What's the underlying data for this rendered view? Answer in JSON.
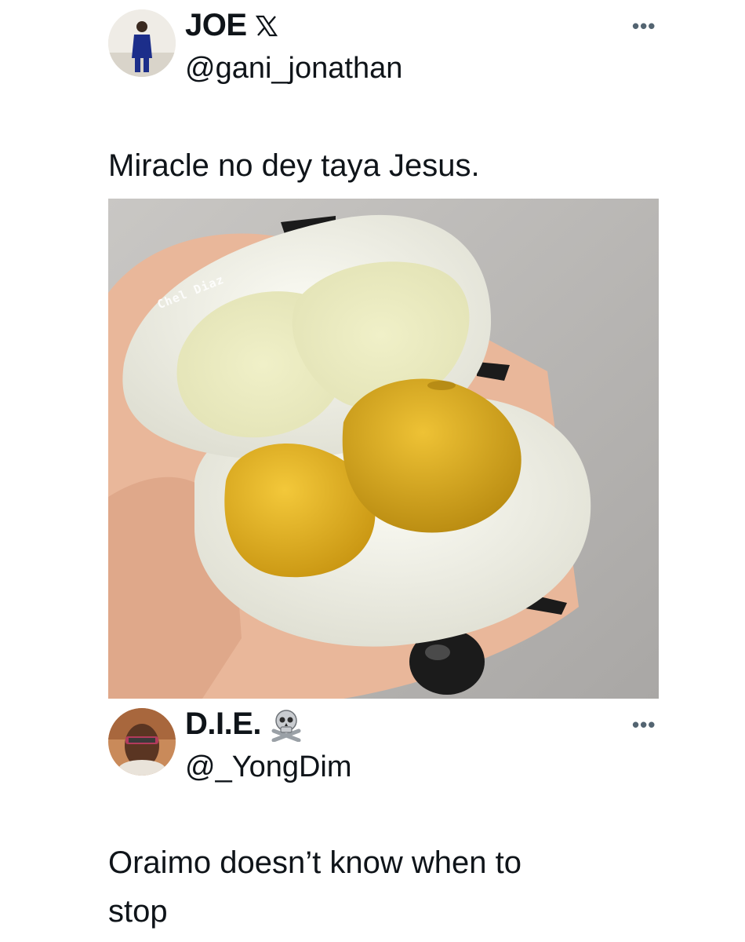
{
  "tweet1": {
    "display_name": "JOE",
    "handle": "@gani_jonathan",
    "text": "Miracle no dey taya Jesus.",
    "more": "•••",
    "badge_icon": "x-logo-icon"
  },
  "media": {
    "watermark": "Chel Diaz",
    "description_icon": "egg-photo"
  },
  "tweet2": {
    "display_name": "D.I.E.",
    "handle": "@_YongDim",
    "text_line1": "Oraimo doesn’t know when to",
    "text_line2": "stop",
    "more": "•••",
    "badge_icon": "skull-crossbones-icon"
  },
  "colors": {
    "text": "#0f1419",
    "secondary": "#536471",
    "yolk": "#e8b82a",
    "white": "#f4f4ee"
  }
}
